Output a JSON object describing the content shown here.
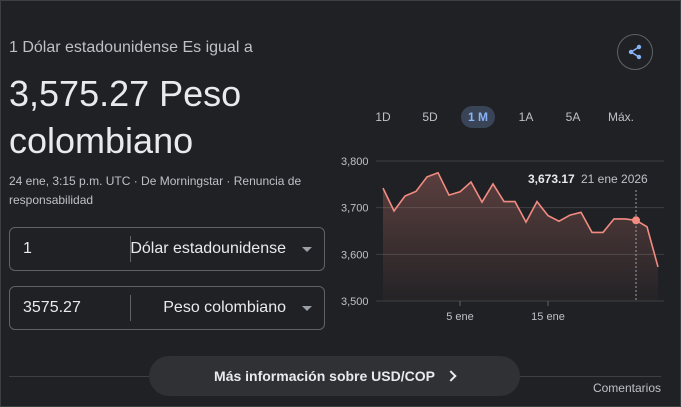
{
  "header": {
    "subtitle": "1 Dólar estadounidense Es igual a",
    "rate_line1": "3,575.27 Peso",
    "rate_line2": "colombiano",
    "meta_line1": "24 ene, 3:15 p.m. UTC · De Morningstar · Renuncia de",
    "meta_line2": "responsabilidad"
  },
  "converter": {
    "from_value": "1",
    "from_currency": "Dólar estadounidense",
    "to_value": "3575.27",
    "to_currency": "Peso colombiano"
  },
  "ranges": [
    "1D",
    "5D",
    "1 M",
    "1A",
    "5A",
    "Máx."
  ],
  "active_range": "1 M",
  "tooltip": {
    "value": "3,673.17",
    "date": "21 ene 2026"
  },
  "chart_data": {
    "type": "area",
    "y_ticks": [
      "3,800",
      "3,700",
      "3,600",
      "3,500"
    ],
    "x_ticks": [
      "5 ene",
      "15 ene"
    ],
    "ylim": [
      3500,
      3800
    ],
    "grid": true,
    "line_color": "#f28b82",
    "values": [
      3742,
      3693,
      3725,
      3735,
      3766,
      3775,
      3727,
      3734,
      3755,
      3712,
      3751,
      3713,
      3713,
      3669,
      3713,
      3683,
      3671,
      3684,
      3690,
      3647,
      3647,
      3676,
      3676,
      3673,
      3659,
      3573
    ],
    "highlight_index": 23,
    "x_tick_indices": [
      7,
      15
    ]
  },
  "footer": {
    "more_button": "Más información sobre USD/COP",
    "feedback": "Comentarios"
  }
}
